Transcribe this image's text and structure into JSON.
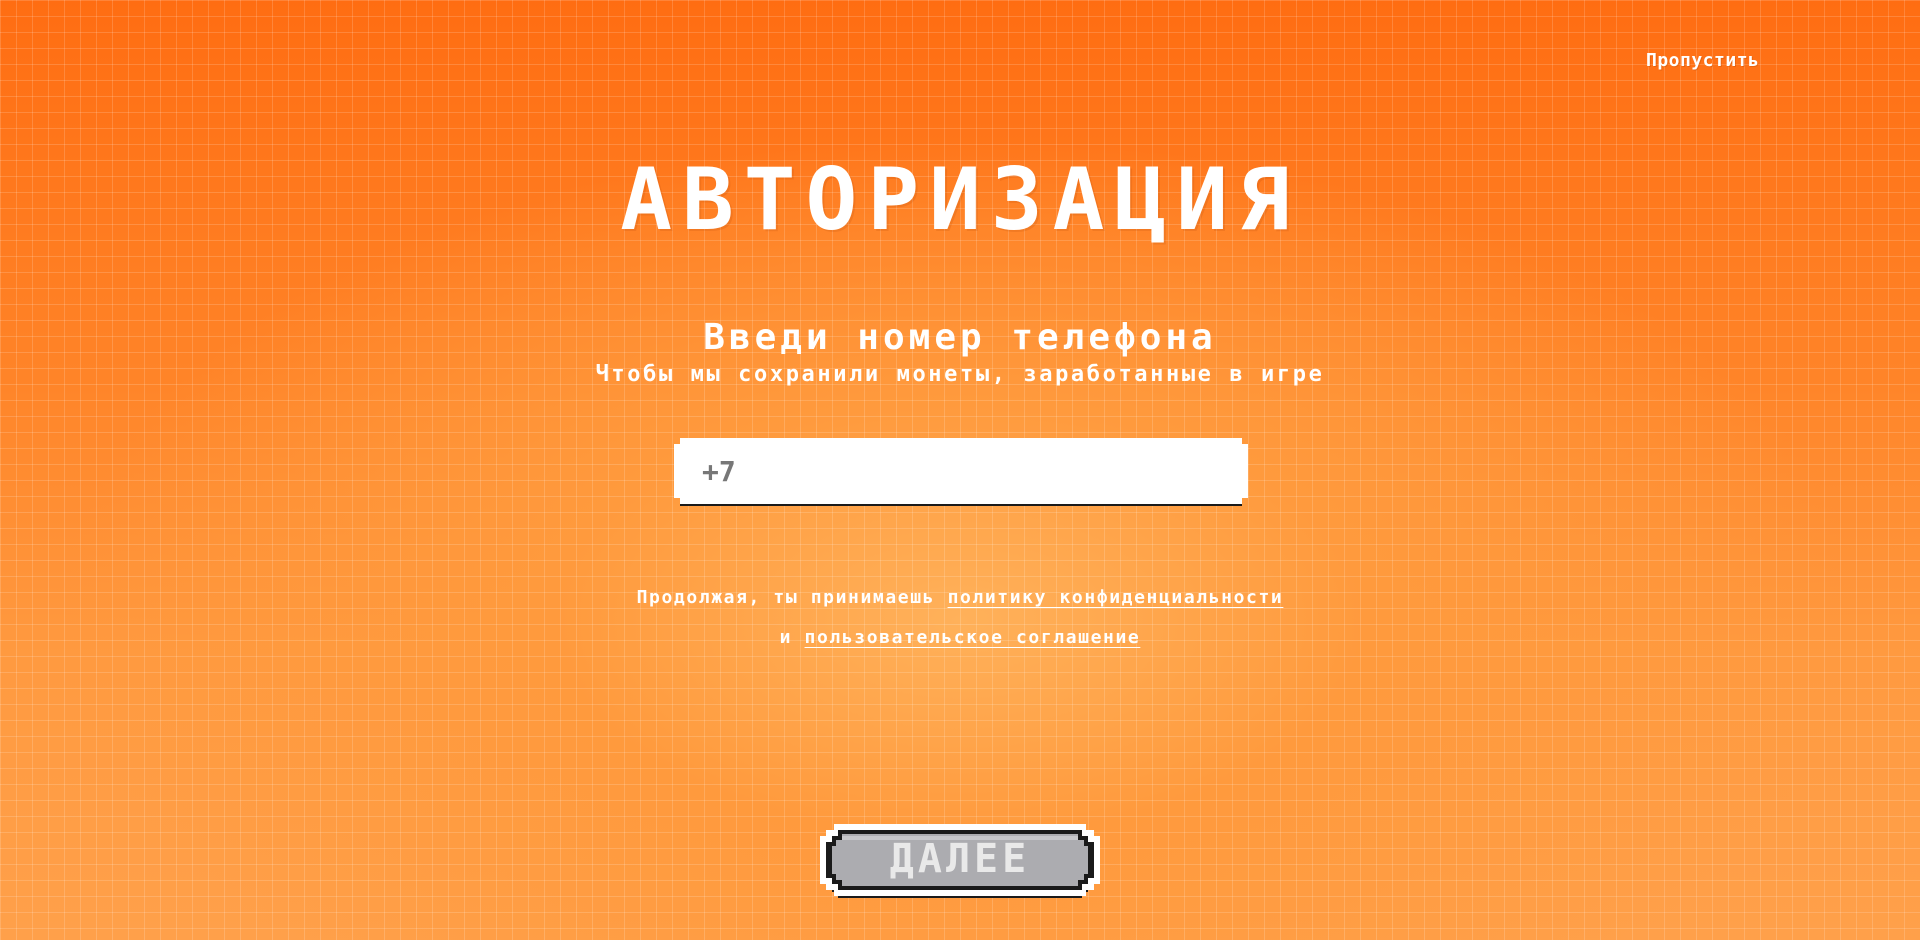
{
  "header": {
    "skip_label": "Пропустить"
  },
  "main": {
    "title": "АВТОРИЗАЦИЯ",
    "subtitle": "Введи номер телефона",
    "description": "Чтобы мы сохранили монеты, заработанные в игре"
  },
  "phone_input": {
    "value": "",
    "placeholder": "+7"
  },
  "consent": {
    "prefix": "Продолжая, ты принимаешь",
    "privacy_link": "политику конфиденциальности",
    "conjunction": "и",
    "terms_link": "пользовательское соглашение"
  },
  "footer": {
    "next_label": "ДАЛЕЕ"
  },
  "colors": {
    "background_top": "#ff6d12",
    "background_center": "#ffb15a",
    "text": "#ffffff",
    "input_background": "#ffffff",
    "button_fill": "#acacb0",
    "button_outline": "#1a1a1a"
  }
}
